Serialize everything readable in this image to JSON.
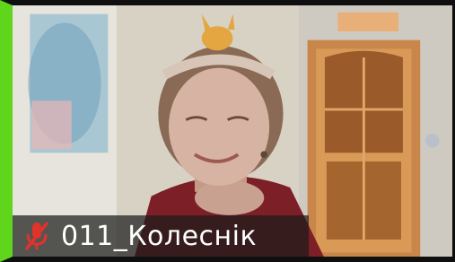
{
  "participant": {
    "name": "011_Колеснік",
    "mic_icon": "mic-muted-icon",
    "mic_muted": true,
    "speaking_indicator_color": "#5fd61c",
    "mic_muted_color": "#e0332b"
  }
}
